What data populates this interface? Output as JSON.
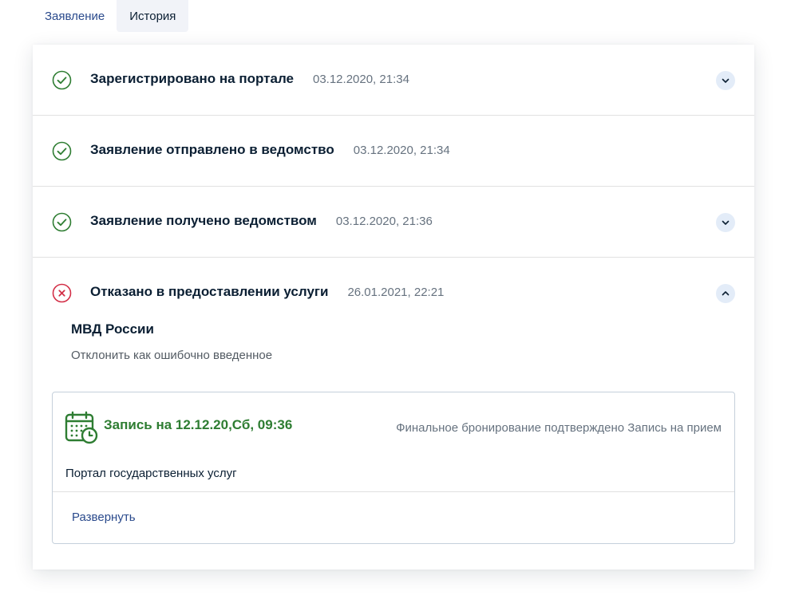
{
  "tabs": [
    {
      "label": "Заявление",
      "active": false
    },
    {
      "label": "История",
      "active": true
    }
  ],
  "history": [
    {
      "title": "Зарегистрировано на портале",
      "date": "03.12.2020, 21:34",
      "status": "success",
      "chevron": "down"
    },
    {
      "title": "Заявление отправлено в ведомство",
      "date": "03.12.2020, 21:34",
      "status": "success",
      "chevron": "none"
    },
    {
      "title": "Заявление получено ведомством",
      "date": "03.12.2020, 21:36",
      "status": "success",
      "chevron": "down"
    },
    {
      "title": "Отказано в предоставлении услуги",
      "date": "26.01.2021, 22:21",
      "status": "error",
      "chevron": "up"
    }
  ],
  "details": {
    "organization": "МВД России",
    "reason": "Отклонить как ошибочно введенное",
    "booking": {
      "title": "Запись на 12.12.20,Сб, 09:36",
      "status": "Финальное бронирование подтверждено Запись на прием",
      "portal": "Портал государственных услуг",
      "expand_label": "Развернуть"
    }
  },
  "colors": {
    "success": "#2e7d32",
    "error": "#d32f47",
    "link": "#2a4a8c",
    "chevron_bg": "#e3ecf8"
  },
  "icons": {
    "success": "check-circle-icon",
    "error": "cross-circle-icon",
    "chevron_down": "chevron-down-icon",
    "chevron_up": "chevron-up-icon",
    "calendar": "calendar-clock-icon"
  }
}
